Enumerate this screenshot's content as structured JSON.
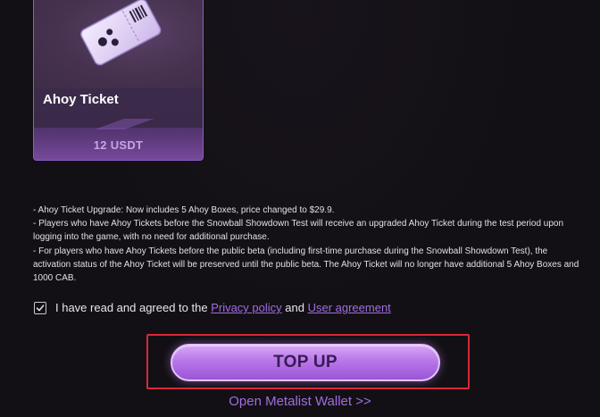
{
  "product": {
    "title": "Ahoy Ticket",
    "price": "12 USDT",
    "image_icon": "ticket-icon"
  },
  "notes": [
    "- Ahoy Ticket Upgrade: Now includes 5 Ahoy Boxes, price changed to $29.9.",
    "- Players who have Ahoy Tickets before the Snowball Showdown Test will receive an upgraded Ahoy Ticket during the test period upon logging into the game, with no need for additional purchase.",
    "- For players who have Ahoy Tickets before the public beta (including first-time purchase during the Snowball Showdown Test), the activation status of the Ahoy Ticket will be preserved until the public beta. The Ahoy Ticket will no longer have additional 5 Ahoy Boxes and 1000 CAB."
  ],
  "agreement": {
    "checked": true,
    "prefix": "I have read and agreed to the ",
    "privacy_link": "Privacy policy",
    "joiner": " and ",
    "user_link": "User agreement"
  },
  "topup_label": "TOP UP",
  "wallet_link": "Open Metalist Wallet >>",
  "colors": {
    "accent": "#a06de0",
    "button": "#b877e8",
    "highlight": "#d9283a",
    "background": "#121014"
  }
}
